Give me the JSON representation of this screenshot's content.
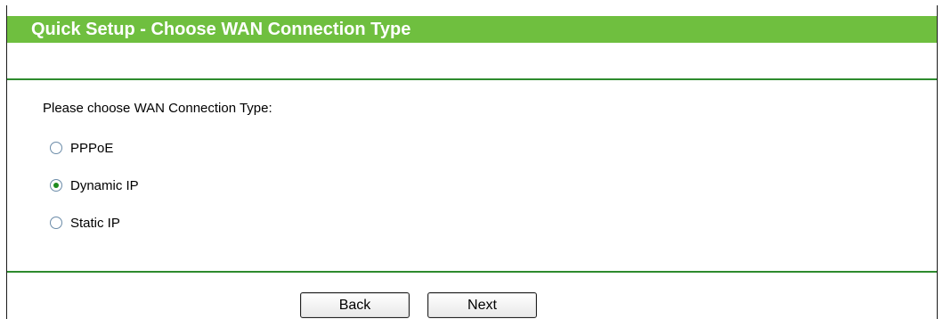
{
  "header": {
    "title": "Quick Setup - Choose WAN Connection Type"
  },
  "form": {
    "prompt": "Please choose WAN Connection Type:",
    "options": [
      {
        "label": "PPPoE",
        "selected": false
      },
      {
        "label": "Dynamic IP",
        "selected": true
      },
      {
        "label": "Static IP",
        "selected": false
      }
    ]
  },
  "buttons": {
    "back_label": "Back",
    "next_label": "Next"
  },
  "colors": {
    "title_bar": "#6fbf3f",
    "rule": "#2e8b2e",
    "radio_dot": "#1f8b1f"
  }
}
